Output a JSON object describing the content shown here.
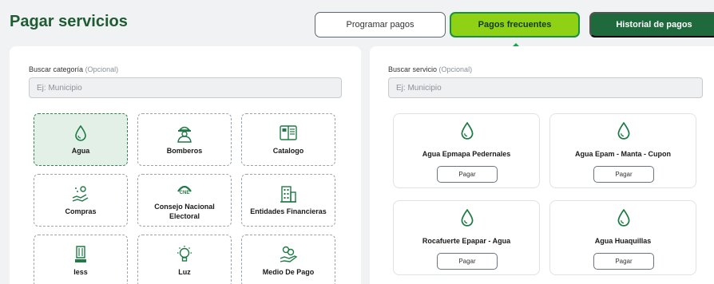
{
  "header": {
    "title": "Pagar servicios",
    "tabs": [
      {
        "label": "Programar pagos"
      },
      {
        "label": "Pagos frecuentes"
      },
      {
        "label": "Historial de pagos"
      }
    ]
  },
  "categories_panel": {
    "search_label": "Buscar categoría",
    "search_optional": "(Opcional)",
    "search_placeholder": "Ej: Municipio",
    "items": [
      {
        "label": "Agua",
        "icon": "water-drop-icon",
        "selected": true
      },
      {
        "label": "Bomberos",
        "icon": "firefighter-icon"
      },
      {
        "label": "Catalogo",
        "icon": "catalog-book-icon"
      },
      {
        "label": "Compras",
        "icon": "shopping-hand-icon"
      },
      {
        "label": "Consejo Nacional Electoral",
        "icon": "cne-logo-icon"
      },
      {
        "label": "Entidades Financieras",
        "icon": "building-icon"
      },
      {
        "label": "Iess",
        "icon": "iess-logo-icon"
      },
      {
        "label": "Luz",
        "icon": "lightbulb-icon"
      },
      {
        "label": "Medio De Pago",
        "icon": "coins-hand-icon"
      }
    ]
  },
  "services_panel": {
    "search_label": "Buscar servicio",
    "search_optional": "(Opcional)",
    "search_placeholder": "Ej: Municipio",
    "items": [
      {
        "name": "Agua Epmapa Pedernales",
        "button": "Pagar"
      },
      {
        "name": "Agua Epam - Manta - Cupon",
        "button": "Pagar"
      },
      {
        "name": "Rocafuerte Epapar - Agua",
        "button": "Pagar"
      },
      {
        "name": "Agua Huaquillas",
        "button": "Pagar"
      }
    ]
  },
  "colors": {
    "brand_green": "#1e6a3d",
    "accent_lime": "#8fd114",
    "arrow_green": "#13a84a",
    "icon_green": "#1f7a45"
  }
}
